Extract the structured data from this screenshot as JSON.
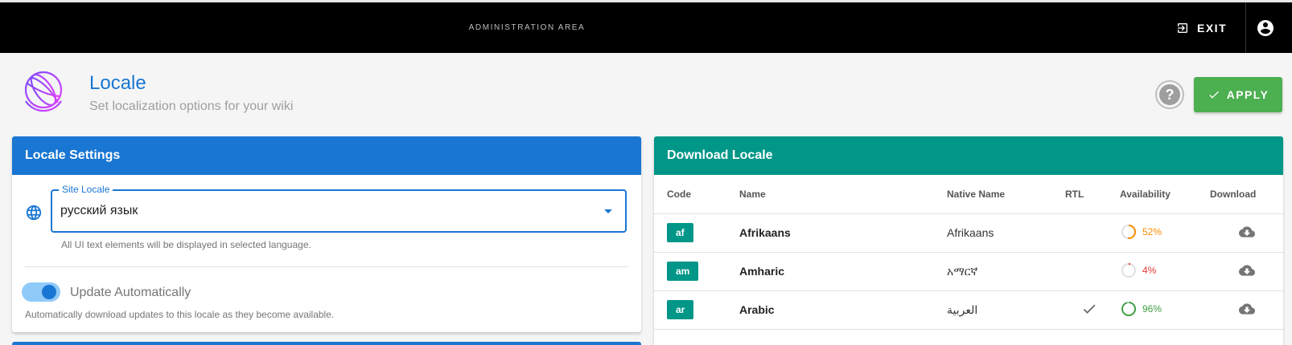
{
  "topbar": {
    "title": "ADMINISTRATION AREA",
    "exit_label": "EXIT"
  },
  "header": {
    "title": "Locale",
    "subtitle": "Set localization options for your wiki",
    "apply_label": "APPLY"
  },
  "locale_settings": {
    "title": "Locale Settings",
    "site_locale_label": "Site Locale",
    "site_locale_value": "русский язык",
    "site_locale_hint": "All UI text elements will be displayed in selected language.",
    "auto_update_label": "Update Automatically",
    "auto_update_enabled": true,
    "auto_update_hint": "Automatically download updates to this locale as they become available."
  },
  "download_locale": {
    "title": "Download Locale",
    "columns": {
      "code": "Code",
      "name": "Name",
      "native": "Native Name",
      "rtl": "RTL",
      "availability": "Availability",
      "download": "Download"
    },
    "rows": [
      {
        "code": "af",
        "name": "Afrikaans",
        "native": "Afrikaans",
        "rtl": false,
        "availability": 52,
        "availability_label": "52%",
        "color": "#fb8c00"
      },
      {
        "code": "am",
        "name": "Amharic",
        "native": "አማርኛ",
        "rtl": false,
        "availability": 4,
        "availability_label": "4%",
        "color": "#e53935"
      },
      {
        "code": "ar",
        "name": "Arabic",
        "native": "العربية",
        "rtl": true,
        "availability": 96,
        "availability_label": "96%",
        "color": "#43a047"
      }
    ]
  },
  "colors": {
    "primary": "#1976d2",
    "teal": "#009688",
    "success": "#4caf50"
  }
}
